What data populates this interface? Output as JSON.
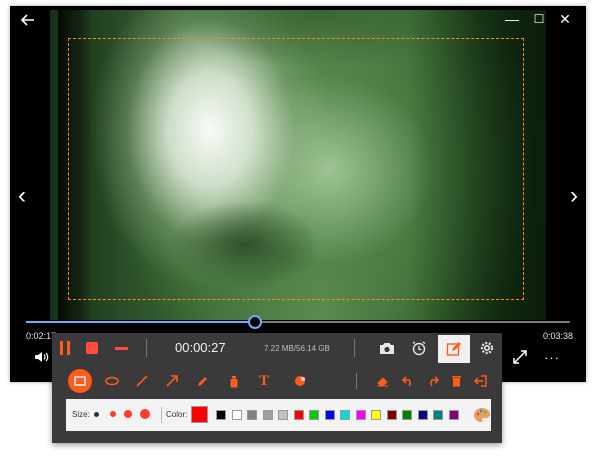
{
  "player": {
    "back_icon": "back-arrow-icon",
    "window_controls": {
      "minimize": "—",
      "maximize": "☐",
      "close": "✕"
    },
    "nav_prev": "‹",
    "nav_next": "›",
    "time_elapsed": "0:02:17",
    "time_total": "0:03:38",
    "playback_progress_percent": 42.0,
    "volume_icon": "speaker-icon",
    "fullscreen_icon": "expand-icon",
    "more_label": "···"
  },
  "recorder": {
    "elapsed": "00:00:27",
    "file_size": "7.22 MB/56.14 GB",
    "colors": {
      "accent": "#ff5c1a",
      "stop": "#ff4b3a",
      "panel": "#3a3a3a"
    }
  },
  "annotation": {
    "tools": [
      {
        "name": "rectangle-tool",
        "icon": "rectangle-icon",
        "active": true
      },
      {
        "name": "ellipse-tool",
        "icon": "ellipse-icon",
        "active": false
      },
      {
        "name": "line-tool",
        "icon": "line-icon",
        "active": false
      },
      {
        "name": "arrow-tool",
        "icon": "arrow-icon",
        "active": false
      },
      {
        "name": "pen-tool",
        "icon": "pen-icon",
        "active": false
      },
      {
        "name": "spray-tool",
        "icon": "spray-icon",
        "active": false
      },
      {
        "name": "text-tool",
        "icon": "text-icon",
        "active": false
      },
      {
        "name": "callout-tool",
        "icon": "callout-icon",
        "active": false
      },
      {
        "name": "eraser-tool",
        "icon": "eraser-icon",
        "active": false
      },
      {
        "name": "undo-tool",
        "icon": "undo-icon",
        "active": false
      },
      {
        "name": "redo-tool",
        "icon": "redo-icon",
        "active": false
      },
      {
        "name": "clear-tool",
        "icon": "trash-icon",
        "active": false
      },
      {
        "name": "exit-tool",
        "icon": "exit-icon",
        "active": false
      }
    ],
    "text_glyph": "T",
    "size_label": "Size:",
    "color_label": "Color:",
    "current_color": "#ff0000",
    "palette": [
      "#000000",
      "#ffffff",
      "#808080",
      "#a0a0a0",
      "#c0c0c0",
      "#ff0000",
      "#00cc00",
      "#0000ff",
      "#00e0e0",
      "#ff00ff",
      "#ffff00",
      "#800000",
      "#008000",
      "#000080",
      "#008080",
      "#800080"
    ]
  }
}
